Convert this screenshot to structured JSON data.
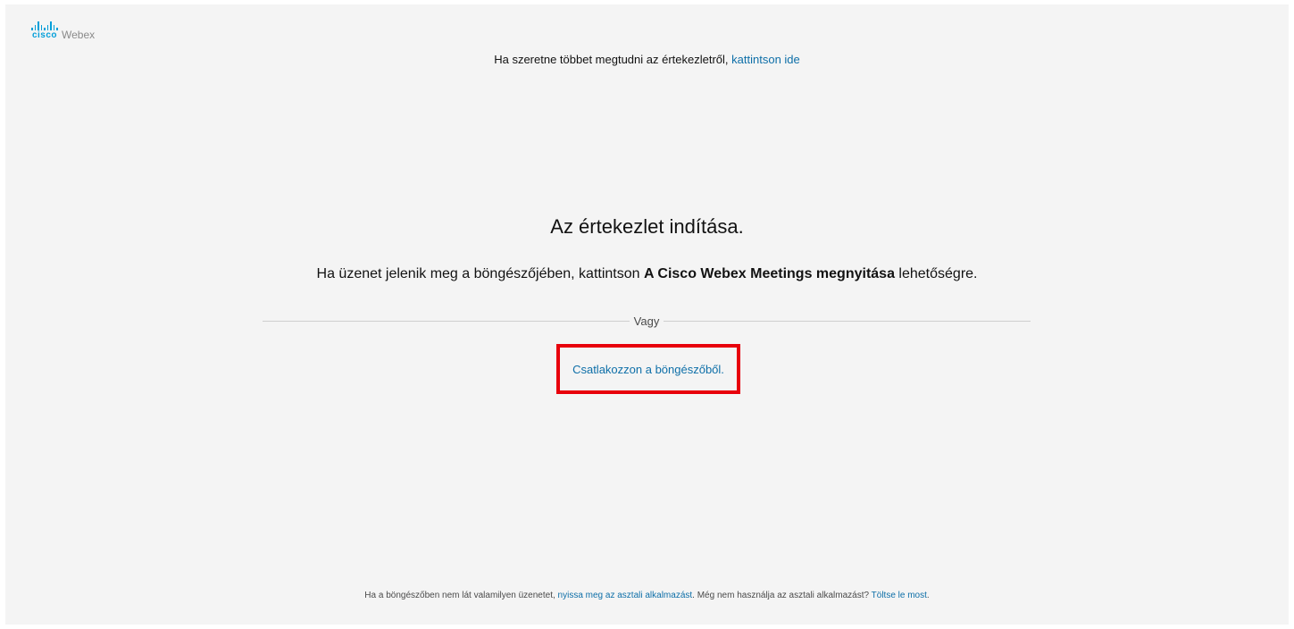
{
  "brand": {
    "cisco": "cisco",
    "product": "Webex",
    "accent_color": "#049fd9"
  },
  "top_info": {
    "text": "Ha szeretne többet megtudni az értekezletről,",
    "link": "kattintson ide"
  },
  "main": {
    "title": "Az értekezlet indítása.",
    "instruction_before": "Ha üzenet jelenik meg a böngészőjében, kattintson",
    "instruction_bold": "A Cisco Webex Meetings megnyitása",
    "instruction_after": "lehetőségre.",
    "divider_label": "Vagy",
    "join_browser_link": "Csatlakozzon a böngészőből.",
    "highlight_color": "#e8000b"
  },
  "footer": {
    "text_before": "Ha a böngészőben nem lát valamilyen üzenetet,",
    "open_app_link": "nyissa meg az asztali alkalmazást",
    "text_middle": ". Még nem használja az asztali alkalmazást?",
    "download_link": "Töltse le most",
    "text_end": "."
  }
}
